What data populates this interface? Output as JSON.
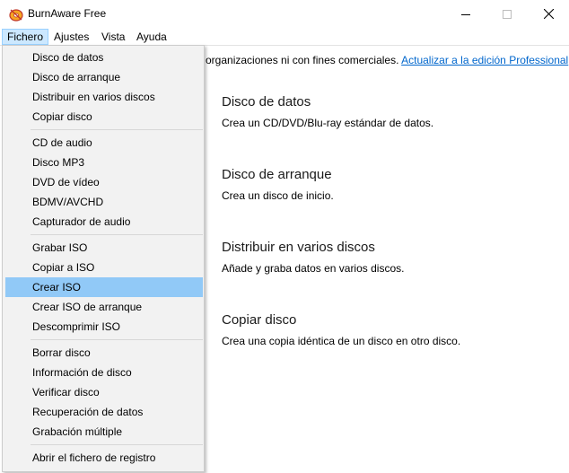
{
  "window": {
    "title": "BurnAware Free",
    "colors": {
      "accent_highlight": "#91c9f7",
      "link": "#0066cc",
      "menu_bg": "#f2f2f2"
    },
    "icons": [
      "burnaware-app-icon",
      "minimize-icon",
      "maximize-icon",
      "close-icon"
    ]
  },
  "menubar": {
    "fichero": "Fichero",
    "ajustes": "Ajustes",
    "vista": "Vista",
    "ayuda": "Ayuda"
  },
  "banner": {
    "text": "organizaciones ni con fines comerciales.",
    "link": "Actualizar a la edición Professional"
  },
  "tasks": [
    {
      "title": "Disco de datos",
      "desc": "Crea un CD/DVD/Blu-ray estándar de datos."
    },
    {
      "title": "Disco de arranque",
      "desc": "Crea un disco de inicio."
    },
    {
      "title": "Distribuir en varios discos",
      "desc": "Añade y graba datos en varios discos."
    },
    {
      "title": "Copiar disco",
      "desc": "Crea una copia idéntica de un disco en otro disco."
    }
  ],
  "fichero_menu": {
    "items": [
      "Disco de datos",
      "Disco de arranque",
      "Distribuir en varios discos",
      "Copiar disco",
      "CD de audio",
      "Disco MP3",
      "DVD de vídeo",
      "BDMV/AVCHD",
      "Capturador de audio",
      "Grabar ISO",
      "Copiar a ISO",
      "Crear ISO",
      "Crear ISO de arranque",
      "Descomprimir ISO",
      "Borrar disco",
      "Información de disco",
      "Verificar disco",
      "Recuperación de datos",
      "Grabación múltiple",
      "Abrir el fichero de registro"
    ],
    "highlighted": "Crear ISO"
  }
}
